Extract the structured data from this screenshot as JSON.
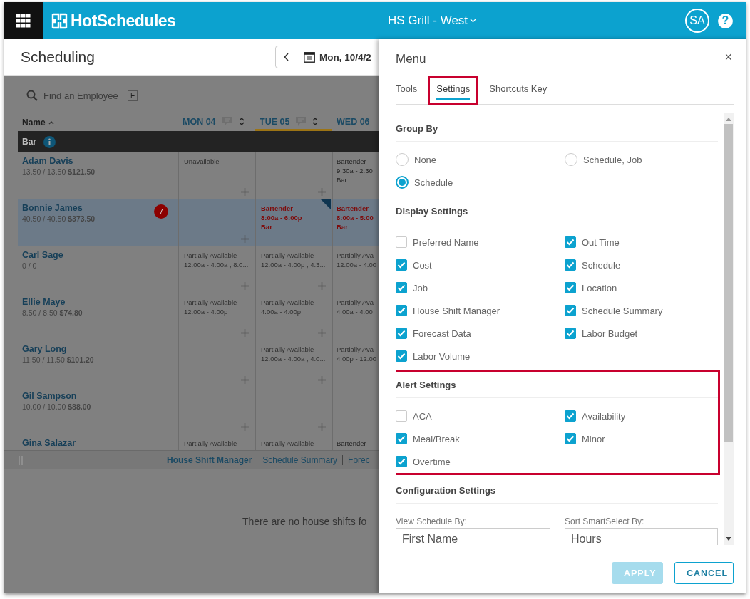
{
  "header": {
    "logo": "HotSchedules",
    "location": "HS Grill - West",
    "avatar": "SA",
    "help": "?"
  },
  "page": {
    "title": "Scheduling",
    "date": "Mon, 10/4/2"
  },
  "search": {
    "placeholder": "Find an Employee",
    "shortcut": "F"
  },
  "name_column": "Name",
  "days": [
    {
      "label": "MON 04",
      "selected": false,
      "cut": false
    },
    {
      "label": "TUE 05",
      "selected": true,
      "cut": false
    },
    {
      "label": "WED 06",
      "selected": false,
      "cut": true
    }
  ],
  "group": {
    "label": "Bar"
  },
  "rows": [
    {
      "name": "Adam Davis",
      "hours": "13.50 / 13.50",
      "cost": "$121.50",
      "selected": false,
      "cells": [
        {
          "kind": "unavailable",
          "lines": [
            "Unavailable"
          ],
          "add": true
        },
        {
          "kind": "empty",
          "add": true
        },
        {
          "kind": "shift",
          "lines": [
            "Bartender",
            "9:30a - 2:30",
            "Bar"
          ],
          "add": false
        }
      ]
    },
    {
      "name": "Bonnie James",
      "hours": "40.50 / 40.50",
      "cost": "$373.50",
      "badge": "7",
      "selected": true,
      "cells": [
        {
          "kind": "empty",
          "add": true
        },
        {
          "kind": "alert_shift",
          "flagged": true,
          "lines": [
            "Bartender",
            "8:00a - 6:00p",
            "Bar"
          ],
          "add": false
        },
        {
          "kind": "alert_shift",
          "lines": [
            "Bartender",
            "8:00a - 5:00",
            "Bar"
          ],
          "add": false
        }
      ]
    },
    {
      "name": "Carl Sage",
      "hours": "0 / 0",
      "selected": false,
      "cells": [
        {
          "kind": "availability",
          "lines": [
            "Partially Available",
            "12:00a - 4:00a , 8:0..."
          ],
          "add": true
        },
        {
          "kind": "availability",
          "lines": [
            "Partially Available",
            "12:00a - 4:00p , 4:3..."
          ],
          "add": true
        },
        {
          "kind": "availability",
          "lines": [
            "Partially Ava",
            "12:00a - 4:00"
          ],
          "add": false
        }
      ]
    },
    {
      "name": "Ellie Maye",
      "hours": "8.50 / 8.50",
      "cost": "$74.80",
      "selected": false,
      "cells": [
        {
          "kind": "availability",
          "lines": [
            "Partially Available",
            "12:00a - 4:00p"
          ],
          "add": true
        },
        {
          "kind": "availability",
          "lines": [
            "Partially Available",
            "4:00a - 4:00p"
          ],
          "add": true
        },
        {
          "kind": "availability",
          "lines": [
            "Partially Ava",
            "4:00a - 4:00"
          ],
          "add": false
        }
      ]
    },
    {
      "name": "Gary Long",
      "hours": "11.50 / 11.50",
      "cost": "$101.20",
      "selected": false,
      "cells": [
        {
          "kind": "empty",
          "add": true
        },
        {
          "kind": "availability",
          "lines": [
            "Partially Available",
            "12:00a - 4:00a , 4:0..."
          ],
          "add": true
        },
        {
          "kind": "availability",
          "lines": [
            "Partially Ava",
            "4:00p - 12:00"
          ],
          "add": false
        }
      ]
    },
    {
      "name": "Gil Sampson",
      "hours": "10.00 / 10.00",
      "cost": "$88.00",
      "selected": false,
      "cells": [
        {
          "kind": "empty",
          "add": true
        },
        {
          "kind": "empty",
          "add": true
        },
        {
          "kind": "empty",
          "add": false
        }
      ]
    },
    {
      "name": "Gina Salazar",
      "selected": false,
      "cells": [
        {
          "kind": "availability",
          "lines": [
            "Partially Available"
          ]
        },
        {
          "kind": "availability",
          "lines": [
            "Partially Available"
          ]
        },
        {
          "kind": "shift",
          "lines": [
            "Bartender"
          ]
        }
      ]
    }
  ],
  "footer_links": [
    {
      "label": "House Shift Manager",
      "selected": true
    },
    {
      "label": "Schedule Summary",
      "selected": false
    },
    {
      "label": "Forec",
      "selected": false
    }
  ],
  "empty_message": "There are no house shifts fo",
  "menu": {
    "title": "Menu",
    "close": "×",
    "tabs": [
      {
        "label": "Tools",
        "selected": false,
        "highlighted": false
      },
      {
        "label": "Settings",
        "selected": true,
        "highlighted": true
      },
      {
        "label": "Shortcuts Key",
        "selected": false,
        "highlighted": false
      }
    ],
    "sections": [
      {
        "kind": "radio",
        "title": "Group By",
        "highlighted": false,
        "options": [
          {
            "label": "None",
            "selected": false
          },
          {
            "label": "Schedule, Job",
            "selected": false
          },
          {
            "label": "Schedule",
            "selected": true
          }
        ]
      },
      {
        "kind": "checkbox",
        "title": "Display Settings",
        "highlighted": false,
        "options": [
          {
            "label": "Preferred Name",
            "checked": false
          },
          {
            "label": "Out Time",
            "checked": true
          },
          {
            "label": "Cost",
            "checked": true
          },
          {
            "label": "Schedule",
            "checked": true
          },
          {
            "label": "Job",
            "checked": true
          },
          {
            "label": "Location",
            "checked": true
          },
          {
            "label": "House Shift Manager",
            "checked": true
          },
          {
            "label": "Schedule Summary",
            "checked": true
          },
          {
            "label": "Forecast Data",
            "checked": true
          },
          {
            "label": "Labor Budget",
            "checked": true
          },
          {
            "label": "Labor Volume",
            "checked": true
          }
        ]
      },
      {
        "kind": "checkbox",
        "title": "Alert Settings",
        "highlighted": true,
        "options": [
          {
            "label": "ACA",
            "checked": false
          },
          {
            "label": "Availability",
            "checked": true
          },
          {
            "label": "Meal/Break",
            "checked": true
          },
          {
            "label": "Minor",
            "checked": true
          },
          {
            "label": "Overtime",
            "checked": true
          }
        ]
      },
      {
        "kind": "fields",
        "title": "Configuration Settings",
        "highlighted": false,
        "fields": [
          {
            "label": "View Schedule By:",
            "value": "First Name"
          },
          {
            "label": "Sort SmartSelect By:",
            "value": "Hours"
          }
        ]
      }
    ],
    "buttons": [
      {
        "label": "APPLY",
        "kind": "primary",
        "disabled": true
      },
      {
        "label": "CANCEL",
        "kind": "secondary",
        "disabled": false
      }
    ]
  }
}
